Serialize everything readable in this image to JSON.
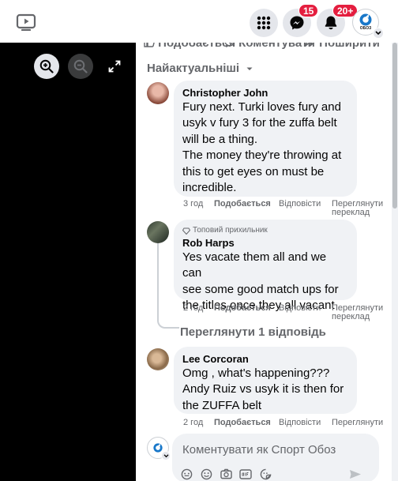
{
  "topbar": {
    "messenger_badge": "15",
    "notifications_badge": "20+",
    "logo_text": "ОБОЗ"
  },
  "post_actions": {
    "like": "Подобається",
    "comment": "Коментувати",
    "share": "Поширити"
  },
  "sort_label": "Найактуальніші",
  "comments": [
    {
      "author": "Christopher John",
      "lines": [
        "Fury next. Turki loves fury and",
        "usyk v fury 3 for the zuffa belt",
        "will be a thing.",
        "The money they're throwing at",
        "this to get eyes on must be",
        "incredible."
      ],
      "time": "3 год",
      "like": "Подобається",
      "reply": "Відповісти",
      "see_translation_1": "Переглянути",
      "see_translation_2": "переклад"
    },
    {
      "badge": "Топовий прихильник",
      "author": "Rob Harps",
      "lines": [
        "Yes vacate them all and we can",
        "see some good match ups for",
        "the titles once they all vacant"
      ],
      "time": "2 год",
      "like": "Подобається",
      "reply": "Відповісти",
      "see_translation_1": "Переглянути",
      "see_translation_2": "переклад",
      "view_replies": "Переглянути 1 відповідь"
    },
    {
      "author": "Lee Corcoran",
      "lines": [
        "Omg , what's happening???",
        "Andy Ruiz vs usyk it is then for",
        "the ZUFFA belt"
      ],
      "time": "2 год",
      "like": "Подобається",
      "reply": "Відповісти",
      "see_translation_1": "Переглянути"
    }
  ],
  "composer": {
    "placeholder": "Коментувати як Спорт Обоз"
  },
  "colors": {
    "badge_red": "#e41e3f",
    "bubble_gray": "#f0f2f5",
    "secondary_text": "#65676b"
  },
  "icons": [
    "watch-icon",
    "menu-grid-icon",
    "messenger-icon",
    "bell-icon",
    "zoom-in-icon",
    "zoom-out-icon",
    "fullscreen-icon",
    "like-icon",
    "comment-icon",
    "share-icon",
    "chevron-down-icon",
    "top-fan-icon",
    "avatar-sticker-icon",
    "emoji-icon",
    "camera-icon",
    "gif-icon",
    "sticker-icon",
    "send-icon"
  ]
}
